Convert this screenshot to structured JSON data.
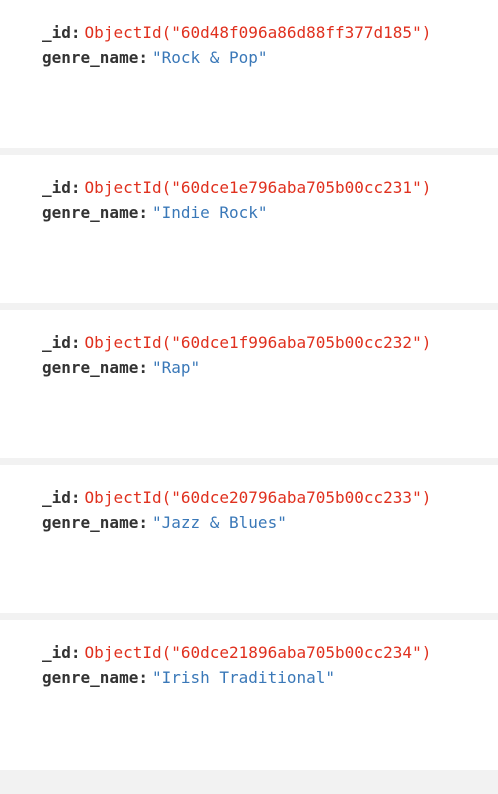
{
  "documents": [
    {
      "id_label": "_id",
      "id_value": "ObjectId(\"60d48f096a86d88ff377d185\")",
      "genre_label": "genre_name",
      "genre_value": "\"Rock & Pop\""
    },
    {
      "id_label": "_id",
      "id_value": "ObjectId(\"60dce1e796aba705b00cc231\")",
      "genre_label": "genre_name",
      "genre_value": "\"Indie Rock\""
    },
    {
      "id_label": "_id",
      "id_value": "ObjectId(\"60dce1f996aba705b00cc232\")",
      "genre_label": "genre_name",
      "genre_value": "\"Rap\""
    },
    {
      "id_label": "_id",
      "id_value": "ObjectId(\"60dce20796aba705b00cc233\")",
      "genre_label": "genre_name",
      "genre_value": "\"Jazz & Blues\""
    },
    {
      "id_label": "_id",
      "id_value": "ObjectId(\"60dce21896aba705b00cc234\")",
      "genre_label": "genre_name",
      "genre_value": "\"Irish Traditional\""
    }
  ],
  "colors": {
    "object_id": "#e0301e",
    "string_value": "#3a78b8",
    "key": "#333333",
    "separator": "#f2f2f2"
  }
}
